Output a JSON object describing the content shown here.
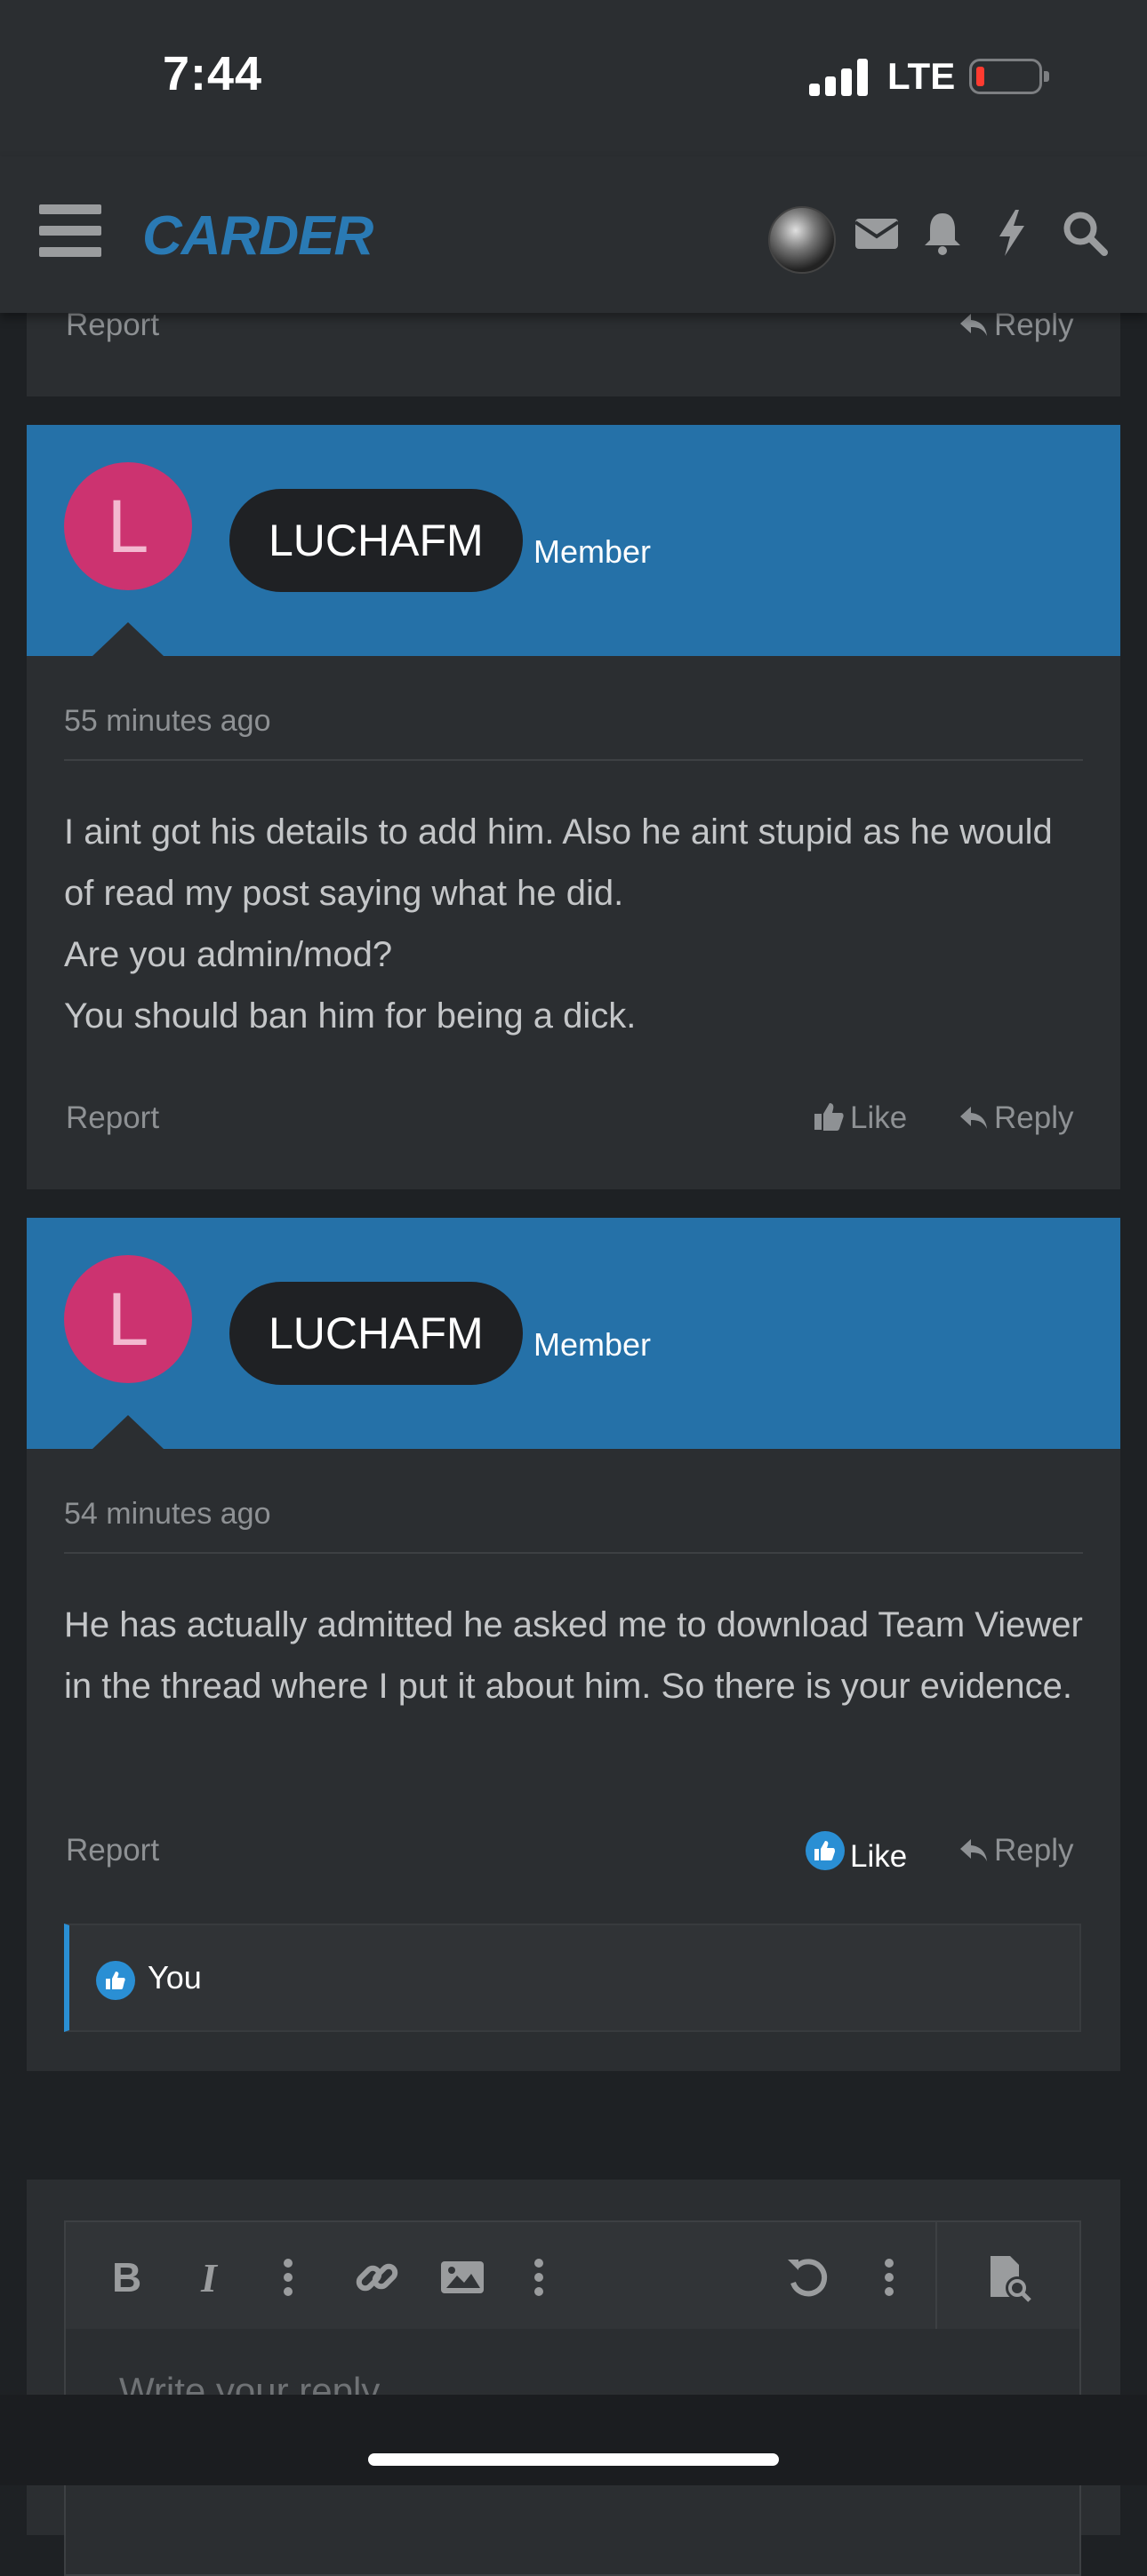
{
  "status_bar": {
    "time": "7:44",
    "network": "LTE",
    "battery_level": "low"
  },
  "nav": {
    "logo": "CARDER",
    "icons": [
      "avatar",
      "envelope-icon",
      "bell-icon",
      "bolt-icon",
      "search-icon"
    ]
  },
  "prev_post": {
    "report": "Report",
    "reply": "Reply"
  },
  "posts": [
    {
      "avatar_letter": "L",
      "username": "LUCHAFM",
      "role": "Member",
      "time": "55 minutes ago",
      "body": [
        "I aint got his details to add him. Also he aint stupid as he would of read my post saying what he did.",
        "Are you admin/mod?",
        "You should ban him for being a dick."
      ],
      "report": "Report",
      "like": "Like",
      "reply": "Reply"
    },
    {
      "avatar_letter": "L",
      "username": "LUCHAFM",
      "role": "Member",
      "time": "54 minutes ago",
      "body": [
        "He has actually admitted he asked me to download Team Viewer in the thread where I put it about him. So there is your evidence."
      ],
      "report": "Report",
      "like": "Like",
      "reply": "Reply",
      "liked_by": "You"
    }
  ],
  "editor": {
    "placeholder": "Write your reply..."
  },
  "colors": {
    "accent": "#2571a8",
    "avatar": "#cc3370",
    "like_blue": "#2a8fd4",
    "background": "#1e2124",
    "card": "#2b2e31"
  }
}
